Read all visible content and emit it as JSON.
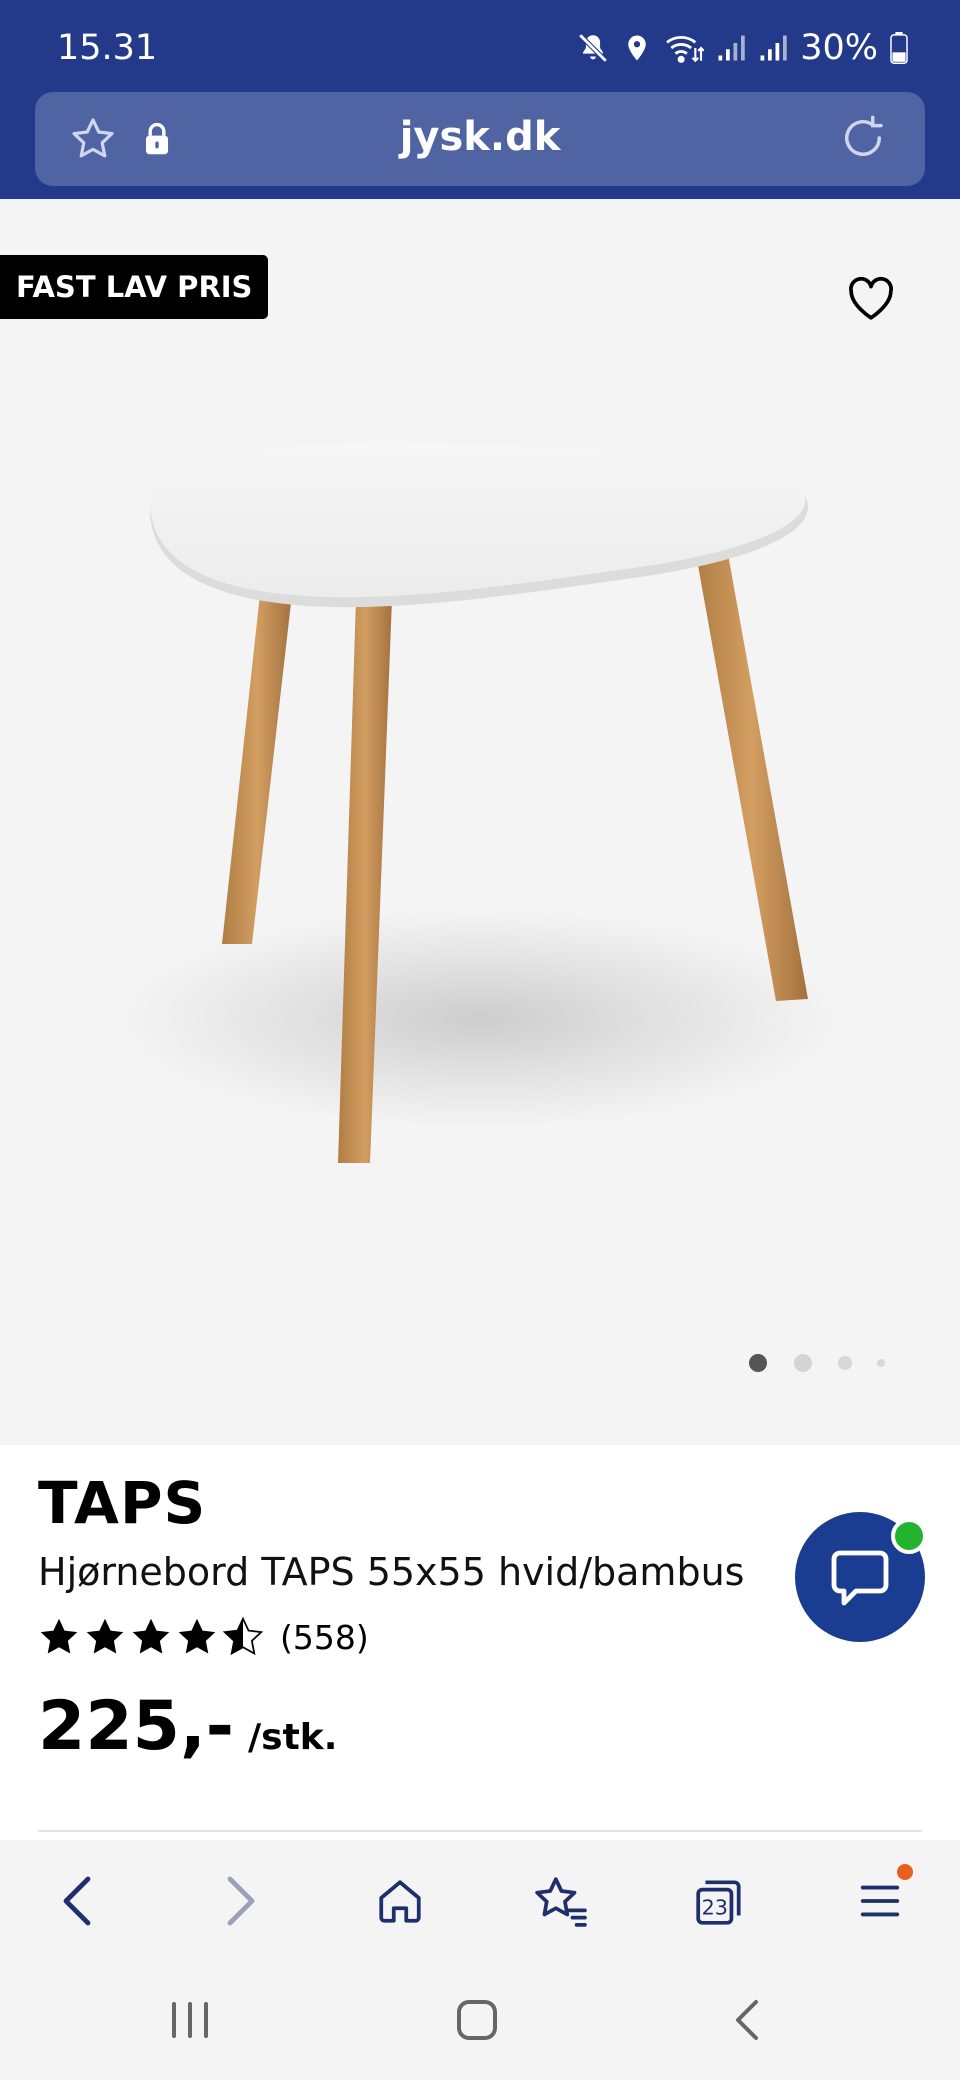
{
  "status_bar": {
    "time": "15.31",
    "battery": "30%"
  },
  "browser": {
    "domain": "jysk.dk",
    "tab_count": "23"
  },
  "gallery": {
    "badge": "FAST LAV PRIS",
    "page_indicator": {
      "count": 4,
      "active": 0
    }
  },
  "product": {
    "brand": "TAPS",
    "name": "Hjørnebord TAPS 55x55 hvid/bambus",
    "rating": 4.5,
    "rating_max": 5,
    "review_count": "(558)",
    "price": "225,-",
    "price_unit": "/stk."
  },
  "colors": {
    "brand_blue": "#233a8a",
    "chat_blue": "#1a3c91",
    "online_green": "#22b32f",
    "notify_orange": "#e8601e"
  },
  "icons": {
    "status": [
      "mute-icon",
      "location-icon",
      "wifi-icon",
      "signal-icon",
      "signal-icon",
      "battery-icon"
    ],
    "toolbar": [
      "back-icon",
      "forward-icon",
      "home-icon",
      "bookmarks-icon",
      "tabs-icon",
      "menu-icon"
    ],
    "navbar": [
      "recents-icon",
      "home-icon",
      "back-icon"
    ]
  }
}
